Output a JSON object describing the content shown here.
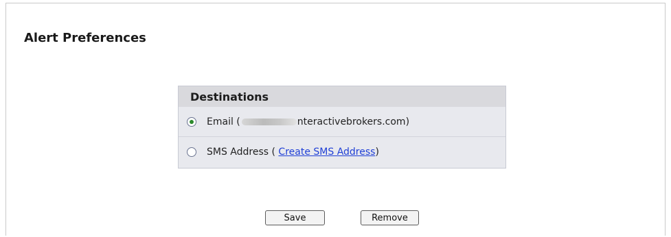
{
  "page": {
    "title": "Alert Preferences"
  },
  "destinations": {
    "header": "Destinations",
    "email": {
      "label": "Email (",
      "address_suffix": "nteractivebrokers.com)",
      "selected": true
    },
    "sms": {
      "label": "SMS Address ( ",
      "link_text": "Create SMS Address",
      "suffix": ")",
      "selected": false
    }
  },
  "buttons": {
    "save": "Save",
    "remove": "Remove"
  },
  "colors": {
    "link": "#1f3fd6",
    "box_background": "#e8e9ee",
    "header_background": "#d9d9dd",
    "radio_selected": "#2c8a2c"
  },
  "icons": {
    "email_radio": "radio-checked",
    "sms_radio": "radio-unchecked"
  }
}
